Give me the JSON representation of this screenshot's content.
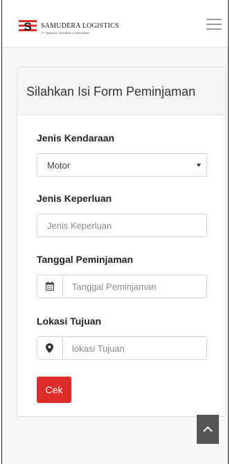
{
  "brand": {
    "name": "SAMUDERA LOGISTICS",
    "subtitle": "PT MASAJI TATANAN CONTAINER",
    "logo_letter": "S",
    "logo_color": "#e02b2b"
  },
  "navbar": {
    "menu_icon": "hamburger-icon"
  },
  "form": {
    "title": "Silahkan Isi Form Peminjaman",
    "jenis_kendaraan": {
      "label": "Jenis Kendaraan",
      "value": "Motor"
    },
    "jenis_keperluan": {
      "label": "Jenis Keperluan",
      "placeholder": "Jenis Keperluan"
    },
    "tanggal_peminjaman": {
      "label": "Tanggal Peminjaman",
      "placeholder": "Tanggal Peminjaman",
      "icon": "calendar-icon"
    },
    "lokasi_tujuan": {
      "label": "Lokasi Tujuan",
      "placeholder": "lokasi Tujuan",
      "icon": "map-marker-icon"
    },
    "submit_label": "Cek"
  },
  "scroll_top": {
    "icon": "chevron-up-icon"
  },
  "colors": {
    "accent": "#e02b2b",
    "header_bg": "#f5f5f5",
    "scroll_button": "#555555"
  }
}
